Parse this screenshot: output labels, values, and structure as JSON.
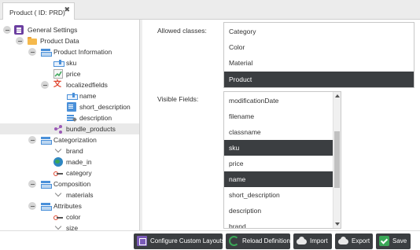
{
  "tab": {
    "title": "Product ( ID: PRD)",
    "close_glyph": "✖"
  },
  "tree": [
    {
      "label": "General Settings",
      "icon": "settings-icon"
    },
    {
      "label": "Product Data",
      "icon": "folder-icon"
    },
    {
      "label": "Product Information",
      "icon": "layout-panel-icon"
    },
    {
      "label": "sku",
      "icon": "input-field-icon"
    },
    {
      "label": "price",
      "icon": "chart-line-icon"
    },
    {
      "label": "localizedfields",
      "icon": "translate-icon"
    },
    {
      "label": "name",
      "icon": "input-field-icon"
    },
    {
      "label": "short_description",
      "icon": "document-icon"
    },
    {
      "label": "description",
      "icon": "textarea-icon"
    },
    {
      "label": "bundle_products",
      "icon": "relation-share-icon"
    },
    {
      "label": "Categorization",
      "icon": "layout-panel-icon"
    },
    {
      "label": "brand",
      "icon": "chevron-down-icon"
    },
    {
      "label": "made_in",
      "icon": "globe-icon"
    },
    {
      "label": "category",
      "icon": "relation-icon"
    },
    {
      "label": "Composition",
      "icon": "layout-panel-icon"
    },
    {
      "label": "materials",
      "icon": "chevron-down-icon"
    },
    {
      "label": "Attributes",
      "icon": "layout-panel-icon"
    },
    {
      "label": "color",
      "icon": "relation-icon"
    },
    {
      "label": "size",
      "icon": "chevron-down-icon"
    }
  ],
  "form": {
    "allowed_classes_label": "Allowed classes:",
    "allowed_classes": [
      {
        "label": "Category",
        "selected": false
      },
      {
        "label": "Color",
        "selected": false
      },
      {
        "label": "Material",
        "selected": false
      },
      {
        "label": "Product",
        "selected": true
      }
    ],
    "visible_fields_label": "Visible Fields:",
    "visible_fields": [
      {
        "label": "modificationDate",
        "selected": false
      },
      {
        "label": "filename",
        "selected": false
      },
      {
        "label": "classname",
        "selected": false
      },
      {
        "label": "sku",
        "selected": true
      },
      {
        "label": "price",
        "selected": false
      },
      {
        "label": "name",
        "selected": true
      },
      {
        "label": "short_description",
        "selected": false
      },
      {
        "label": "description",
        "selected": false
      },
      {
        "label": "brand",
        "selected": false
      }
    ]
  },
  "toolbar": {
    "configure_layouts": "Configure Custom Layouts",
    "reload": "Reload Definition",
    "import": "Import",
    "export": "Export",
    "save": "Save"
  },
  "colors": {
    "selected_bg": "#3b3e41",
    "button_bg": "#3b3e41",
    "save_green": "#3aa757"
  }
}
